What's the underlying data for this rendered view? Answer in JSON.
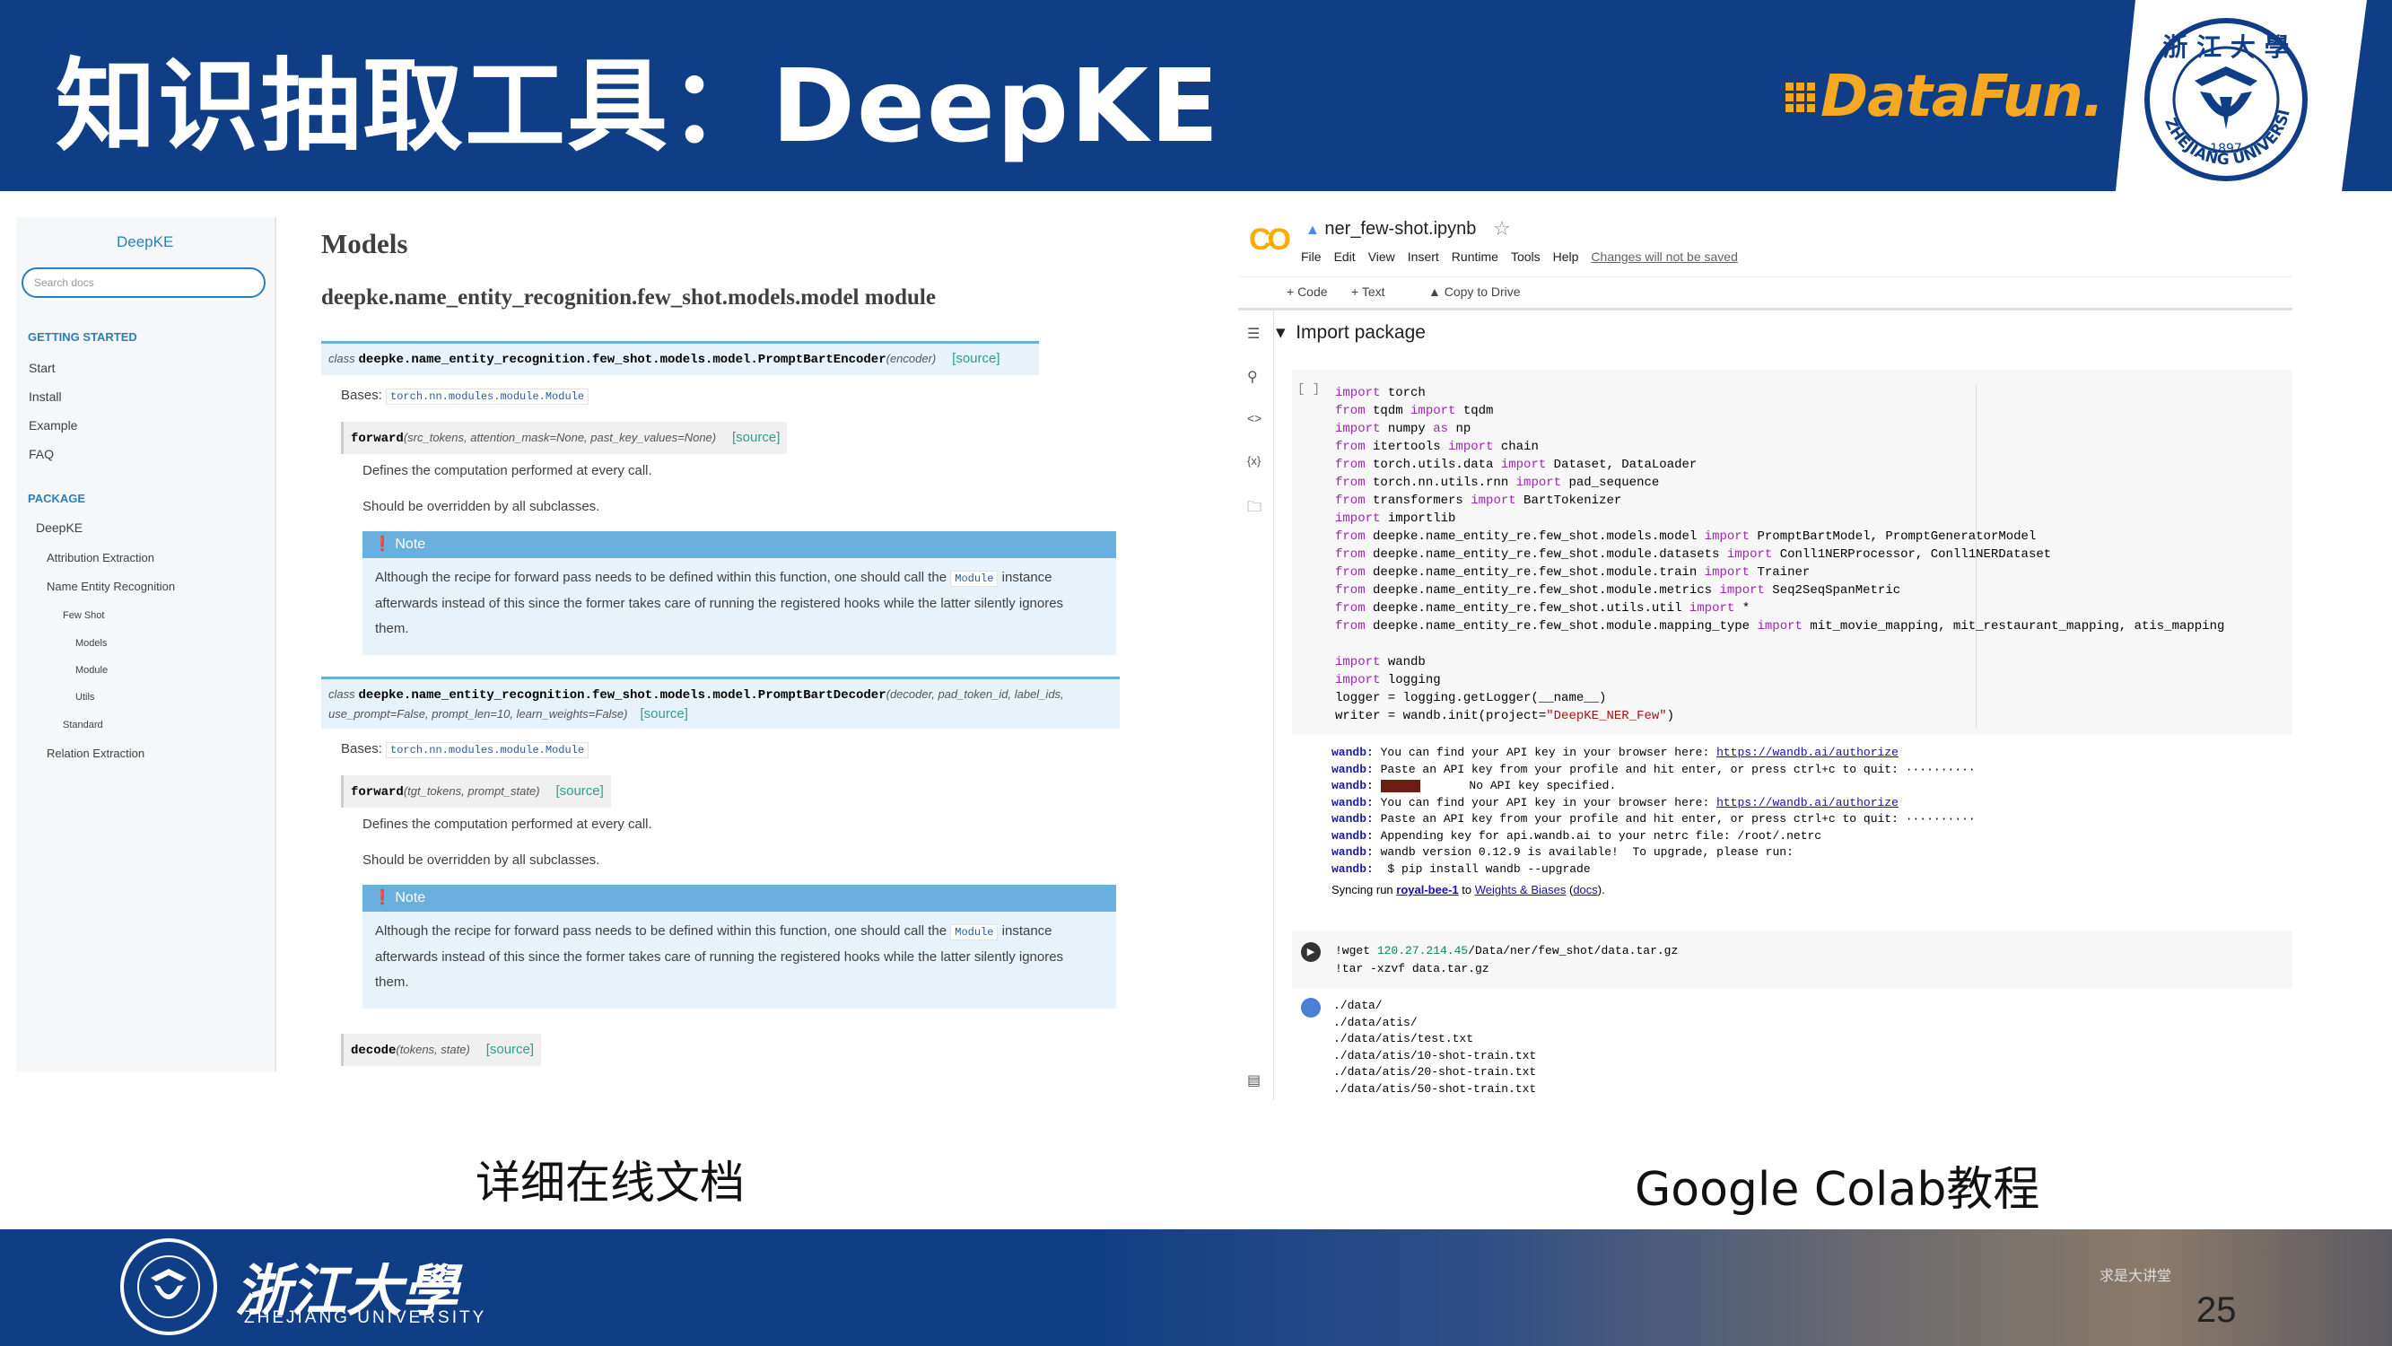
{
  "slide": {
    "title": "知识抽取工具：DeepKE",
    "caption_left": "详细在线文档",
    "caption_right": "Google Colab教程",
    "page_number": "25"
  },
  "branding": {
    "datafun": "DataFun.",
    "zju_seal_text": "ZHEJIANG UNIVERSITY",
    "zju_seal_year": "1897",
    "footer_name_cn": "浙江大學",
    "footer_name_en": "ZHEJIANG UNIVERSITY",
    "footer_sign": "求是大讲堂",
    "colors": {
      "navy": "#0f3e86",
      "datafun_orange": "#f7a823",
      "colab_orange": "#f9ab00"
    }
  },
  "doc": {
    "brand": "DeepKE",
    "search_placeholder": "Search docs",
    "getting_started": "GETTING STARTED",
    "nav_start": [
      "Start",
      "Install",
      "Example",
      "FAQ"
    ],
    "package": "PACKAGE",
    "nav_pkg": {
      "deepke": "DeepKE",
      "attr": "Attribution Extraction",
      "ner": "Name Entity Recognition",
      "fewshot": "Few Shot",
      "models": "Models",
      "module": "Module",
      "utils": "Utils",
      "standard": "Standard",
      "relation": "Relation Extraction"
    },
    "page_title": "Models",
    "module_title": "deepke.name_entity_recognition.few_shot.models.model module",
    "class1": {
      "kw": "class",
      "name": "deepke.name_entity_recognition.few_shot.models.model.PromptBartEncoder",
      "params": "(encoder)",
      "source": "[source]",
      "bases_label": "Bases:",
      "bases": "torch.nn.modules.module.Module",
      "method": "forward",
      "method_params": "(src_tokens, attention_mask=None, past_key_values=None)",
      "desc1": "Defines the computation performed at every call.",
      "desc2": "Should be overridden by all subclasses.",
      "note_label": "Note",
      "note_a": "Although the recipe for forward pass needs to be defined within this function, one should call the",
      "note_code": "Module",
      "note_b": "instance",
      "note_c": "afterwards instead of this since the former takes care of running the registered hooks while the latter silently ignores",
      "note_d": "them."
    },
    "class2": {
      "kw": "class",
      "name": "deepke.name_entity_recognition.few_shot.models.model.PromptBartDecoder",
      "params1": "(decoder, pad_token_id, label_ids,",
      "params2": "use_prompt=False, prompt_len=10, learn_weights=False)",
      "source": "[source]",
      "bases_label": "Bases:",
      "bases": "torch.nn.modules.module.Module",
      "method": "forward",
      "method_params": "(tgt_tokens, prompt_state)",
      "desc1": "Defines the computation performed at every call.",
      "desc2": "Should be overridden by all subclasses.",
      "note_label": "Note",
      "note_a": "Although the recipe for forward pass needs to be defined within this function, one should call the",
      "note_code": "Module",
      "note_b": "instance",
      "note_c": "afterwards instead of this since the former takes care of running the registered hooks while the latter silently ignores",
      "note_d": "them.",
      "method2": "decode",
      "method2_params": "(tokens, state)"
    }
  },
  "colab": {
    "logo": "CO",
    "notebook": "ner_few-shot.ipynb",
    "menu": [
      "File",
      "Edit",
      "View",
      "Insert",
      "Runtime",
      "Tools",
      "Help"
    ],
    "unsaved": "Changes will not be saved",
    "tb_code": "+ Code",
    "tb_text": "+ Text",
    "tb_copy": "Copy to Drive",
    "section": "Import package",
    "bracket": "[ ]",
    "cell1": [
      [
        "import",
        " torch"
      ],
      [
        "from",
        " tqdm ",
        "import",
        " tqdm"
      ],
      [
        "import",
        " numpy ",
        "as",
        " np"
      ],
      [
        "from",
        " itertools ",
        "import",
        " chain"
      ],
      [
        "from",
        " torch.utils.data ",
        "import",
        " Dataset, DataLoader"
      ],
      [
        "from",
        " torch.nn.utils.rnn ",
        "import",
        " pad_sequence"
      ],
      [
        "from",
        " transformers ",
        "import",
        " BartTokenizer"
      ],
      [
        "import",
        " importlib"
      ],
      [
        "from",
        " deepke.name_entity_re.few_shot.models.model ",
        "import",
        " PromptBartModel, PromptGeneratorModel"
      ],
      [
        "from",
        " deepke.name_entity_re.few_shot.module.datasets ",
        "import",
        " Conll1NERProcessor, Conll1NERDataset"
      ],
      [
        "from",
        " deepke.name_entity_re.few_shot.module.train ",
        "import",
        " Trainer"
      ],
      [
        "from",
        " deepke.name_entity_re.few_shot.module.metrics ",
        "import",
        " Seq2SeqSpanMetric"
      ],
      [
        "from",
        " deepke.name_entity_re.few_shot.utils.util ",
        "import",
        " *"
      ],
      [
        "from",
        " deepke.name_entity_re.few_shot.module.mapping_type ",
        "import",
        " mit_movie_mapping, mit_restaurant_mapping, atis_mapping"
      ]
    ],
    "cell1b": [
      [
        "import",
        " wandb"
      ],
      [
        "import",
        " logging"
      ],
      [
        "",
        "logger = logging.getLogger(__name__)"
      ],
      [
        "",
        "writer = wandb.init(project=",
        "\"DeepKE_NER_Few\"",
        ")"
      ]
    ],
    "wandb_out": [
      [
        "wandb:",
        " You can find your API key in your browser here: ",
        "https://wandb.ai/authorize"
      ],
      [
        "wandb:",
        " Paste an API key from your profile and hit enter, or press ctrl+c to quit: ··········",
        ""
      ],
      [
        "wandb:",
        "       No API key specified.",
        ""
      ],
      [
        "wandb:",
        " You can find your API key in your browser here: ",
        "https://wandb.ai/authorize"
      ],
      [
        "wandb:",
        " Paste an API key from your profile and hit enter, or press ctrl+c to quit: ··········",
        ""
      ],
      [
        "wandb:",
        " Appending key for api.wandb.ai to your netrc file: /root/.netrc",
        ""
      ],
      [
        "wandb:",
        " wandb version 0.12.9 is available!  To upgrade, please run:",
        ""
      ],
      [
        "wandb:",
        "  $ pip install wandb --upgrade",
        ""
      ]
    ],
    "sync": {
      "pre": "Syncing run ",
      "run": "royal-bee-1",
      "mid": " to ",
      "wb": "Weights & Biases",
      "docs_pre": " (",
      "docs": "docs",
      "docs_post": ")."
    },
    "cell2": [
      "!wget ",
      "120.27.214.45",
      "/Data/ner/few_shot/data.tar.gz",
      "!tar -xzvf data.tar.gz"
    ],
    "cell2_out": [
      "./data/",
      "./data/atis/",
      "./data/atis/test.txt",
      "./data/atis/10-shot-train.txt",
      "./data/atis/20-shot-train.txt",
      "./data/atis/50-shot-train.txt"
    ]
  }
}
